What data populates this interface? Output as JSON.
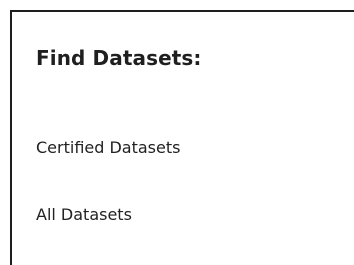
{
  "panel": {
    "heading": "Find Datasets:",
    "links": [
      {
        "label": "Certified Datasets"
      },
      {
        "label": "All Datasets"
      }
    ]
  },
  "colors": {
    "heading_text": "#1f1f1f",
    "link_text": "#222222",
    "border": "#1e1e1e",
    "background": "#ffffff"
  }
}
